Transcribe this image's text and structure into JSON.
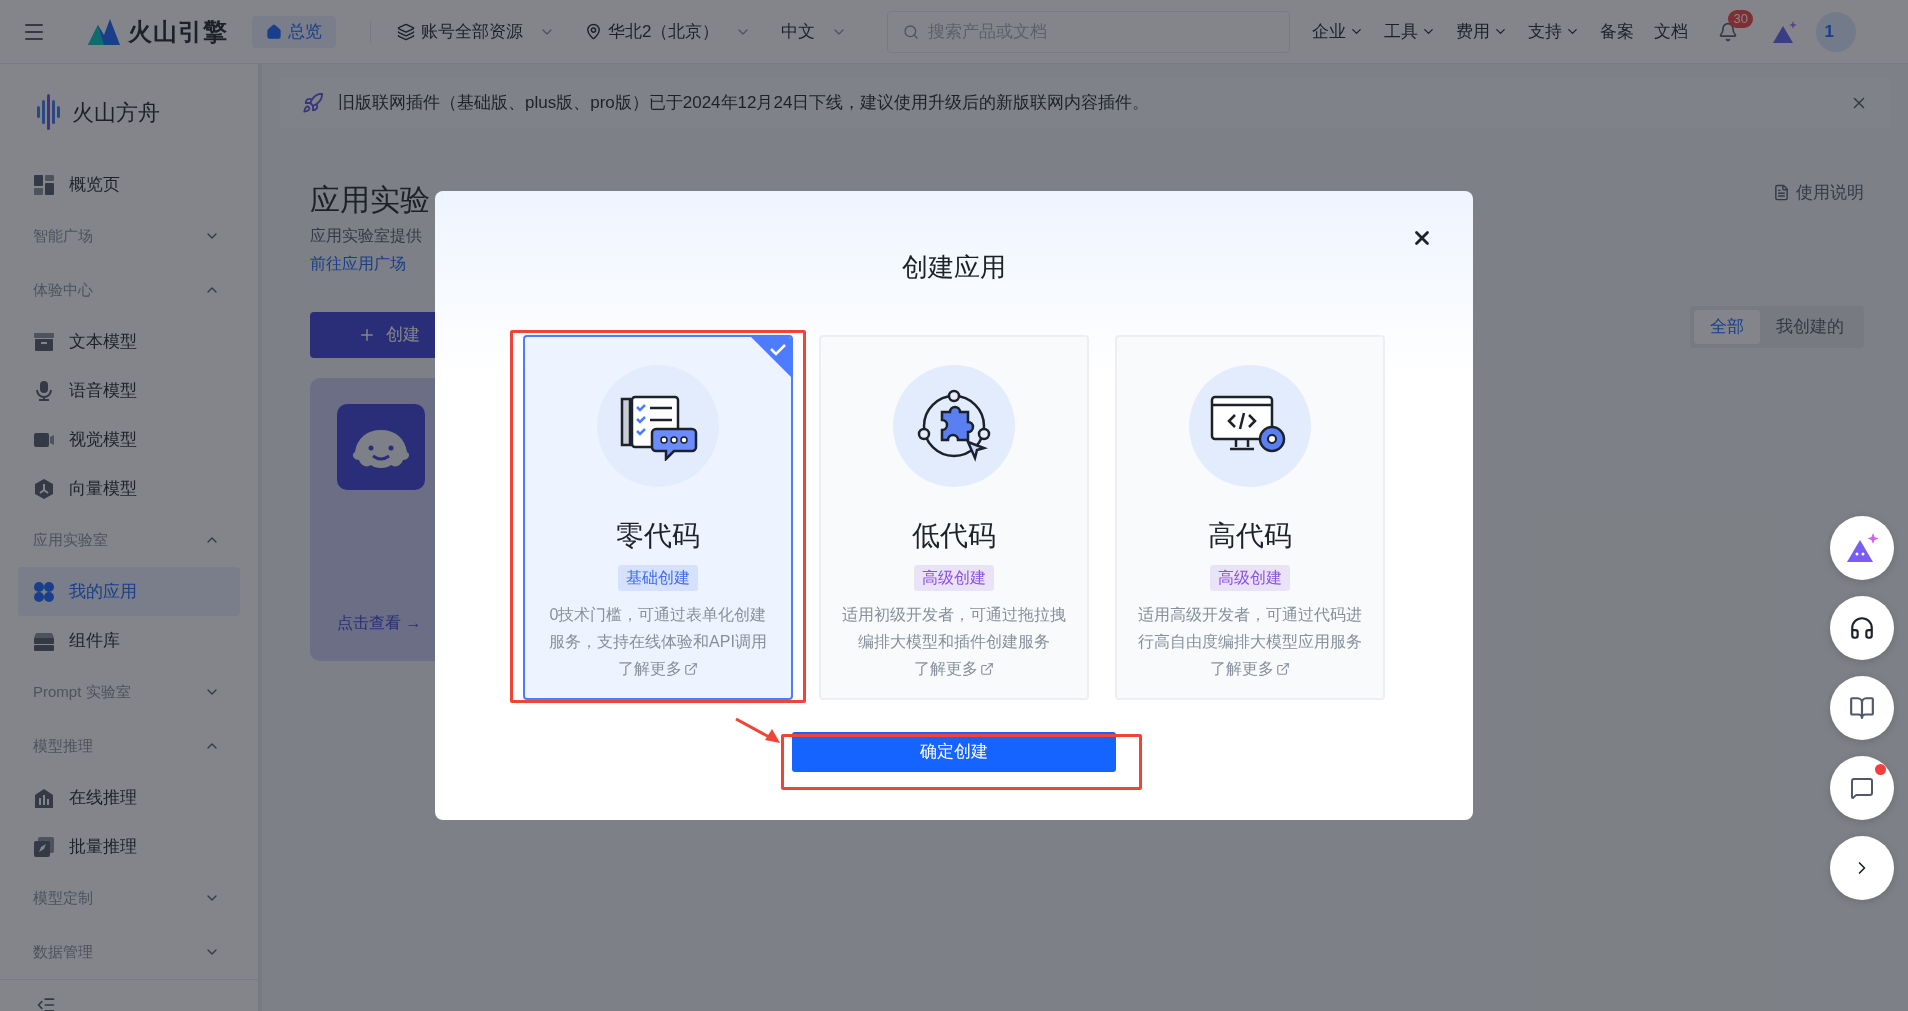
{
  "top_bar": {
    "brand": "火山引擎",
    "home": "总览",
    "selectors": [
      {
        "label": "账号全部资源"
      },
      {
        "label": "华北2（北京）"
      },
      {
        "label": "中文"
      }
    ],
    "search": {
      "placeholder": "搜索产品或文档"
    },
    "menus": [
      {
        "label": "企业",
        "dropdown": true
      },
      {
        "label": "工具",
        "dropdown": true
      },
      {
        "label": "费用",
        "dropdown": true
      },
      {
        "label": "支持",
        "dropdown": true
      },
      {
        "label": "备案",
        "dropdown": false
      },
      {
        "label": "文档",
        "dropdown": false
      }
    ],
    "notifications": {
      "badge": "30"
    },
    "avatar": "1"
  },
  "sidebar": {
    "title": "火山方舟",
    "entries": [
      {
        "kind": "link",
        "label": "概览页",
        "selected": false
      },
      {
        "kind": "group",
        "label": "智能广场",
        "expanded": false
      },
      {
        "kind": "group",
        "label": "体验中心",
        "expanded": true,
        "children": [
          {
            "label": "文本模型",
            "selected": false
          },
          {
            "label": "语音模型",
            "selected": false
          },
          {
            "label": "视觉模型",
            "selected": false
          },
          {
            "label": "向量模型",
            "selected": false
          }
        ]
      },
      {
        "kind": "group",
        "label": "应用实验室",
        "expanded": true,
        "children": [
          {
            "label": "我的应用",
            "selected": true
          },
          {
            "label": "组件库",
            "selected": false
          }
        ]
      },
      {
        "kind": "group",
        "label": "Prompt 实验室",
        "expanded": false
      },
      {
        "kind": "group",
        "label": "模型推理",
        "expanded": true,
        "children": [
          {
            "label": "在线推理",
            "selected": false
          },
          {
            "label": "批量推理",
            "selected": false
          }
        ]
      },
      {
        "kind": "group",
        "label": "模型定制",
        "expanded": false
      },
      {
        "kind": "group",
        "label": "数据管理",
        "expanded": false
      }
    ]
  },
  "banner": {
    "text": "旧版联网插件（基础版、plus版、pro版）已于2024年12月24日下线，建议使用升级后的新版联网内容插件。"
  },
  "page": {
    "title": "应用实验",
    "description": "应用实验室提供",
    "link": "前往应用广场",
    "create_button": "创建",
    "guide": "使用说明",
    "filter_tabs": [
      {
        "label": "全部",
        "selected": true
      },
      {
        "label": "我创建的",
        "selected": false
      }
    ],
    "app_card": {
      "link": "点击查看 →"
    }
  },
  "modal": {
    "title": "创建应用",
    "confirm": "确定创建",
    "options": [
      {
        "title": "零代码",
        "tag": "基础创建",
        "color": "#3c6cf0",
        "description": "0技术门槛，可通过表单化创建服务，支持在线体验和API调用",
        "link": "了解更多",
        "selected": true
      },
      {
        "title": "低代码",
        "tag": "高级创建",
        "color": "#8e4fe0",
        "description": "适用初级开发者，可通过拖拉拽编排大模型和插件创建服务",
        "link": "了解更多",
        "selected": false
      },
      {
        "title": "高代码",
        "tag": "高级创建",
        "color": "#8e4fe0",
        "description": "适用高级开发者，可通过代码进行高自由度编排大模型应用服务",
        "link": "了解更多",
        "selected": false
      }
    ]
  }
}
